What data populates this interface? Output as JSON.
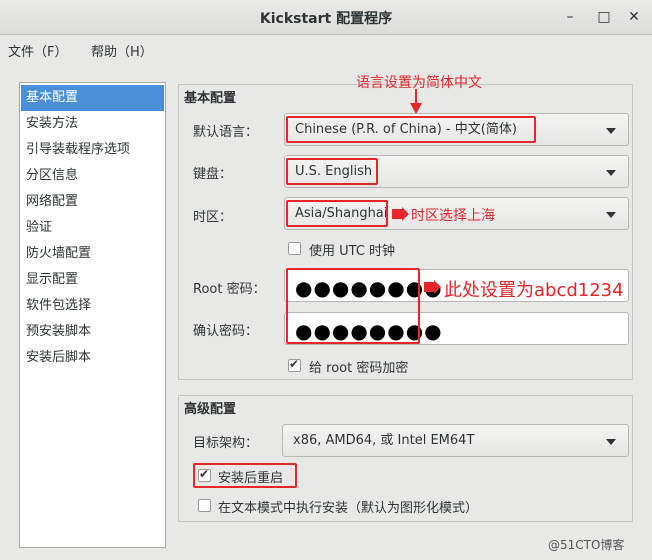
{
  "window": {
    "title": "Kickstart 配置程序",
    "minimize": "–",
    "maximize": "□",
    "close": "✕"
  },
  "menubar": {
    "file": "文件（F）",
    "help": "帮助（H）"
  },
  "sidebar": {
    "items": [
      {
        "label": "基本配置",
        "selected": true
      },
      {
        "label": "安装方法"
      },
      {
        "label": "引导装载程序选项"
      },
      {
        "label": "分区信息"
      },
      {
        "label": "网络配置"
      },
      {
        "label": "验证"
      },
      {
        "label": "防火墙配置"
      },
      {
        "label": "显示配置"
      },
      {
        "label": "软件包选择"
      },
      {
        "label": "预安装脚本"
      },
      {
        "label": "安装后脚本"
      }
    ]
  },
  "basic": {
    "title": "基本配置",
    "language_label": "默认语言：",
    "language_value": "Chinese (P.R. of China) - 中文(简体)",
    "keyboard_label": "键盘：",
    "keyboard_value": "U.S. English",
    "timezone_label": "时区：",
    "timezone_value": "Asia/Shanghai",
    "utc_label": "使用 UTC 时钟",
    "utc_checked": false,
    "root_label": "Root 密码：",
    "root_value": "●●●●●●●●",
    "confirm_label": "确认密码：",
    "confirm_value": "●●●●●●●●",
    "encrypt_label": "给 root 密码加密",
    "encrypt_checked": true
  },
  "advanced": {
    "title": "高级配置",
    "arch_label": "目标架构：",
    "arch_value": "x86, AMD64, 或 Intel EM64T",
    "reboot_label": "安装后重启",
    "reboot_checked": true,
    "textmode_label": "在文本模式中执行安装（默认为图形化模式）",
    "textmode_checked": false
  },
  "annotations": {
    "language": "语言设置为简体中文",
    "timezone": "时区选择上海",
    "password": "此处设置为abcd1234",
    "accent_color": "#e5262b"
  },
  "watermark": "@51CTO博客"
}
